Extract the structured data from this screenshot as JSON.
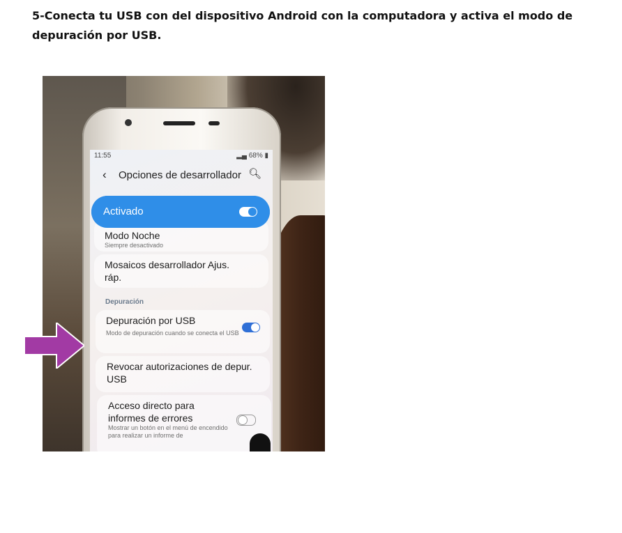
{
  "heading": "5-Conecta tu USB con del dispositivo Android con la computadora y activa el modo de depuración por USB.",
  "arrow_color": "#a23aa4",
  "phone_screen": {
    "status_time": "11:55",
    "status_battery": "68%",
    "app_title": "Opciones de desarrollador",
    "master_switch_label": "Activado",
    "master_switch_on": true,
    "items": [
      {
        "title": "Modo Noche",
        "subtitle": "Siempre desactivado"
      },
      {
        "title": "Mosaicos desarrollador Ajus. ráp."
      }
    ],
    "section_label": "Depuración",
    "usb_debug": {
      "title": "Depuración por USB",
      "subtitle": "Modo de depuración cuando se conecta el USB",
      "on": true
    },
    "revoke": {
      "title": "Revocar autorizaciones de depur. USB"
    },
    "bug_report": {
      "title": "Acceso directo para informes de errores",
      "subtitle": "Mostrar un botón en el menú de encendido para realizar un informe de",
      "on": false
    }
  }
}
